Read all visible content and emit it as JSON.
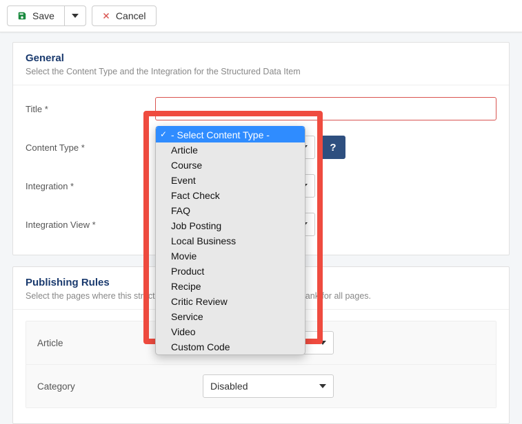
{
  "toolbar": {
    "save_label": "Save",
    "cancel_label": "Cancel"
  },
  "general": {
    "heading": "General",
    "description": "Select the Content Type and the Integration for the Structured Data Item",
    "fields": {
      "title_label": "Title *",
      "content_type_label": "Content Type *",
      "integration_label": "Integration *",
      "integration_view_label": "Integration View *"
    },
    "help_label": "?"
  },
  "content_type_dropdown": {
    "placeholder": "- Select Content Type -",
    "options": [
      "Article",
      "Course",
      "Event",
      "Fact Check",
      "FAQ",
      "Job Posting",
      "Local Business",
      "Movie",
      "Product",
      "Recipe",
      "Critic Review",
      "Service",
      "Video",
      "Custom Code"
    ]
  },
  "publishing": {
    "heading": "Publishing Rules",
    "description": "Select the pages where this structured data item gets published. Leave blank for all pages.",
    "rows": {
      "article_label": "Article",
      "article_value": "",
      "category_label": "Category",
      "category_value": "Disabled"
    }
  },
  "colors": {
    "accent": "#2e4f7f",
    "highlight": "#ef4b3f",
    "select_highlight": "#2f8cff"
  }
}
